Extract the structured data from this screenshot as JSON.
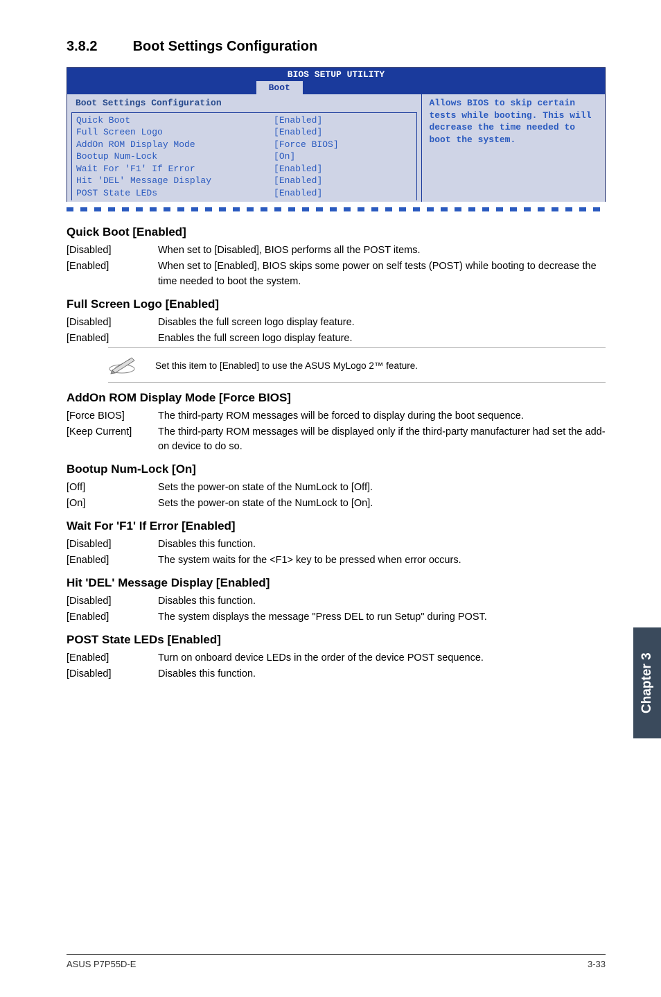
{
  "section": {
    "number": "3.8.2",
    "title": "Boot Settings Configuration"
  },
  "bios": {
    "title": "BIOS SETUP UTILITY",
    "tab": "Boot",
    "groupTitle": "Boot Settings Configuration",
    "rows": [
      {
        "key": "Quick Boot",
        "val": "[Enabled]"
      },
      {
        "key": "Full Screen Logo",
        "val": "[Enabled]"
      },
      {
        "key": "AddOn ROM Display Mode",
        "val": "[Force BIOS]"
      },
      {
        "key": "Bootup Num-Lock",
        "val": "[On]"
      },
      {
        "key": "Wait For 'F1' If Error",
        "val": "[Enabled]"
      },
      {
        "key": "Hit 'DEL' Message Display",
        "val": "[Enabled]"
      },
      {
        "key": "POST State LEDs",
        "val": "[Enabled]"
      }
    ],
    "help": "Allows BIOS to skip certain tests while booting. This will decrease the time needed to boot the system."
  },
  "settings": [
    {
      "title": "Quick Boot [Enabled]",
      "opts": [
        {
          "k": "[Disabled]",
          "v": "When set to [Disabled], BIOS performs all the POST items."
        },
        {
          "k": "[Enabled]",
          "v": "When set to [Enabled], BIOS skips some power on self tests (POST) while booting to decrease the time needed to boot the system."
        }
      ]
    },
    {
      "title": "Full Screen Logo [Enabled]",
      "opts": [
        {
          "k": "[Disabled]",
          "v": "Disables the full screen logo display feature."
        },
        {
          "k": "[Enabled]",
          "v": "Enables the full screen logo display feature."
        }
      ],
      "note": "Set this item to [Enabled] to use the ASUS MyLogo 2™ feature."
    },
    {
      "title": "AddOn ROM Display Mode [Force BIOS]",
      "opts": [
        {
          "k": "[Force BIOS]",
          "v": "The third-party ROM messages will be forced to display during the boot sequence."
        },
        {
          "k": "[Keep Current]",
          "v": "The third-party ROM messages will be displayed only if the third-party manufacturer had set the add-on device to do so."
        }
      ]
    },
    {
      "title": "Bootup Num-Lock [On]",
      "opts": [
        {
          "k": "[Off]",
          "v": "Sets the power-on state of the NumLock to [Off]."
        },
        {
          "k": "[On]",
          "v": "Sets the power-on state of the NumLock to [On]."
        }
      ]
    },
    {
      "title": "Wait For 'F1' If Error [Enabled]",
      "opts": [
        {
          "k": "[Disabled]",
          "v": "Disables this function."
        },
        {
          "k": "[Enabled]",
          "v": "The system waits for the <F1> key to be pressed when error occurs."
        }
      ]
    },
    {
      "title": "Hit 'DEL' Message Display [Enabled]",
      "opts": [
        {
          "k": "[Disabled]",
          "v": "Disables this function."
        },
        {
          "k": "[Enabled]",
          "v": "The system displays the message \"Press DEL to run Setup\" during POST."
        }
      ]
    },
    {
      "title": "POST State LEDs [Enabled]",
      "opts": [
        {
          "k": "[Enabled]",
          "v": "Turn on onboard device LEDs in the order of the device POST sequence."
        },
        {
          "k": "[Disabled]",
          "v": "Disables this function."
        }
      ]
    }
  ],
  "sideTab": "Chapter 3",
  "footer": {
    "left": "ASUS P7P55D-E",
    "right": "3-33"
  }
}
